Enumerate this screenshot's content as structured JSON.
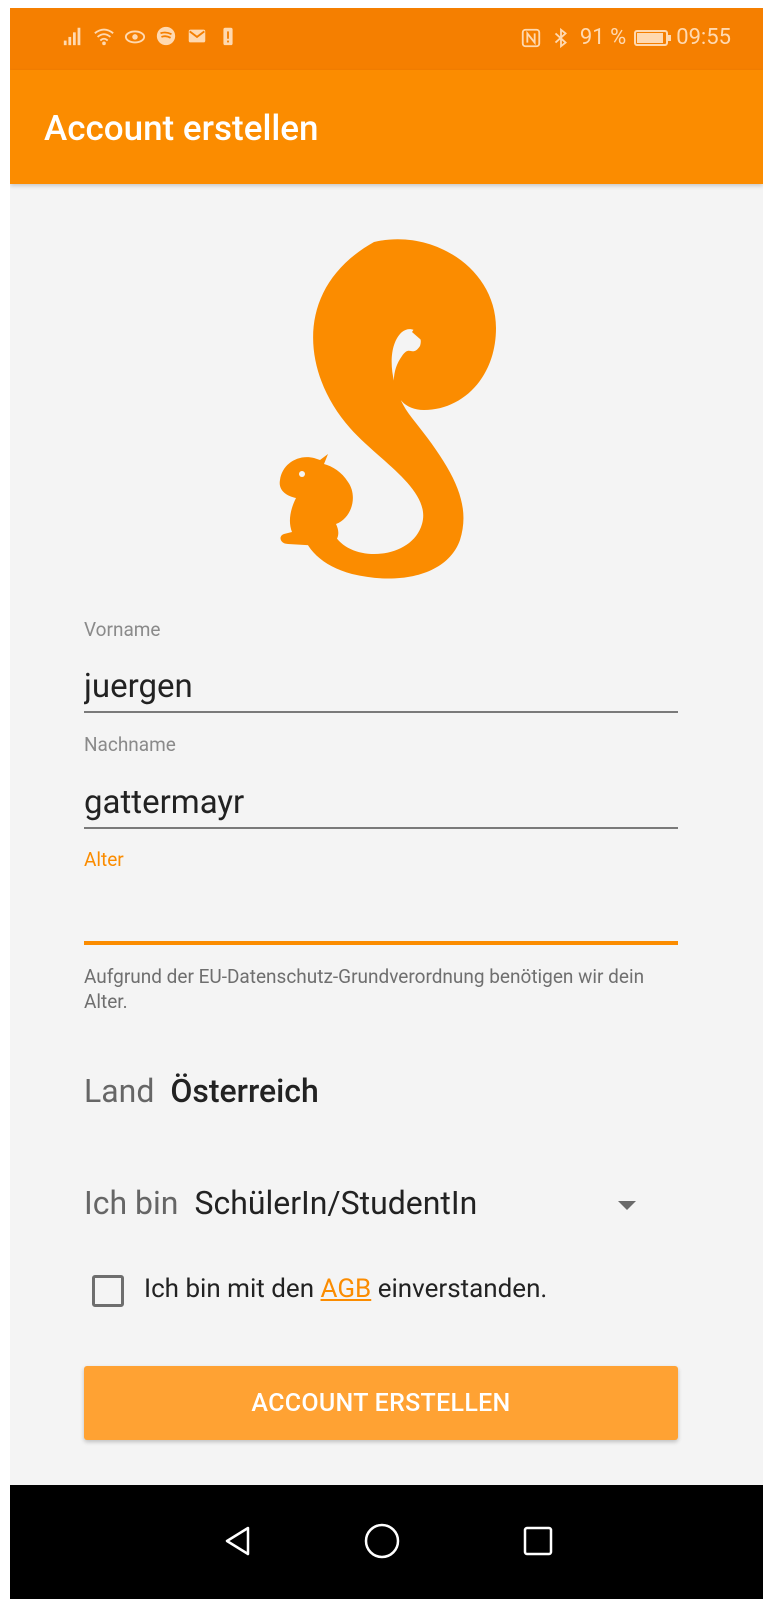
{
  "status_bar": {
    "battery_text": "91 %",
    "battery_level": 0.91,
    "time": "09:55",
    "left_icons": [
      "signal-icon",
      "wifi-icon",
      "eye-icon",
      "spotify-icon",
      "mail-icon",
      "battery-alert-icon"
    ],
    "right_icons": [
      "nfc-icon",
      "bluetooth-icon",
      "battery-icon"
    ]
  },
  "app_bar": {
    "title": "Account erstellen"
  },
  "brand": {
    "accent": "#fb8c00",
    "status_bar_color": "#f57f00",
    "button_color": "#ffa233"
  },
  "form": {
    "first_name": {
      "label": "Vorname",
      "value": "juergen"
    },
    "last_name": {
      "label": "Nachname",
      "value": "gattermayr"
    },
    "age": {
      "label": "Alter",
      "value": ""
    },
    "age_helper": "Aufgrund der EU-Datenschutz-Grundverordnung benötigen wir dein Alter.",
    "country": {
      "label": "Land",
      "value": "Österreich"
    },
    "role": {
      "label": "Ich bin",
      "value": "SchülerIn/StudentIn"
    },
    "terms": {
      "prefix": "Ich bin mit den ",
      "link": "AGB",
      "suffix": " einverstanden.",
      "checked": false
    },
    "submit_label": "ACCOUNT ERSTELLEN"
  },
  "nav_bar": {
    "icons": [
      "back-icon",
      "home-icon",
      "recents-icon"
    ]
  }
}
